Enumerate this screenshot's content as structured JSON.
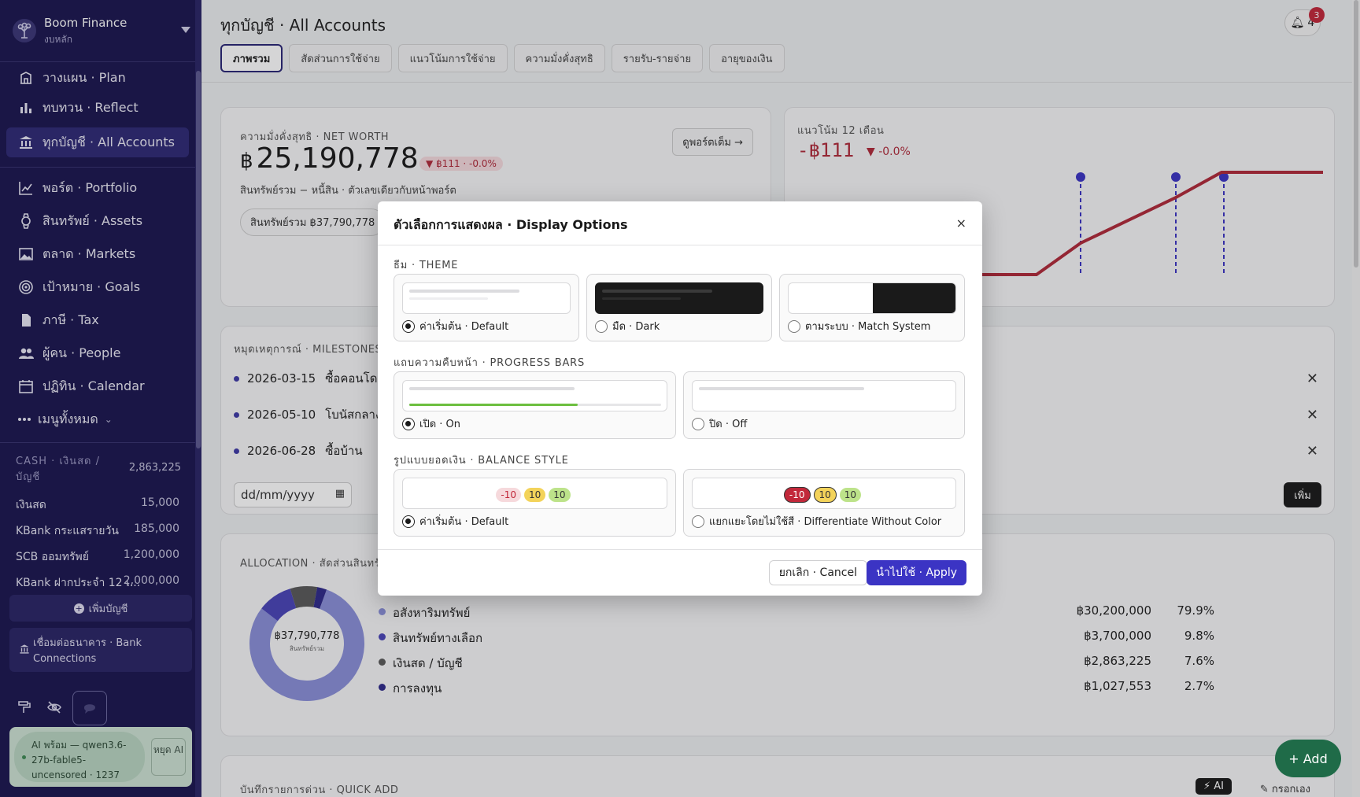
{
  "sidebar": {
    "brand_name": "Boom Finance",
    "brand_sub": "งบหลัก",
    "nav": [
      {
        "label": "วางแผน · Plan",
        "icon": "plan-icon"
      },
      {
        "label": "ทบทวน · Reflect",
        "icon": "reflect-icon"
      },
      {
        "label": "ทุกบัญชี · All Accounts",
        "icon": "bank-icon"
      },
      {
        "label": "พอร์ต · Portfolio",
        "icon": "portfolio-icon"
      },
      {
        "label": "สินทรัพย์ · Assets",
        "icon": "assets-icon"
      },
      {
        "label": "ตลาด · Markets",
        "icon": "markets-icon"
      },
      {
        "label": "เป้าหมาย · Goals",
        "icon": "goals-icon"
      },
      {
        "label": "ภาษี · Tax",
        "icon": "tax-icon"
      },
      {
        "label": "ผู้คน · People",
        "icon": "people-icon"
      },
      {
        "label": "ปฏิทิน · Calendar",
        "icon": "calendar-icon"
      }
    ],
    "more_label": "เมนูทั้งหมด",
    "cash_header": "CASH · เงินสด / บัญชี",
    "cash_total": "2,863,225",
    "accounts": [
      {
        "name": "เงินสด",
        "value": "15,000"
      },
      {
        "name": "KBank กระแสรายวัน",
        "value": "185,000"
      },
      {
        "name": "SCB ออมทรัพย์",
        "value": "1,200,000"
      },
      {
        "name": "KBank ฝากประจำ 12 เ...",
        "value": "2,000,000"
      }
    ],
    "add_account": "เพิ่มบัญชี",
    "bank_connections": "เชื่อมต่อธนาคาร · Bank Connections",
    "ai_status": "AI พร้อม — qwen3.6-27b-fable5-uncensored · 1237",
    "ai_stop": "หยุด AI"
  },
  "header": {
    "title": "ทุกบัญชี · All Accounts",
    "notif_count": "4",
    "notif_badge": "3",
    "tabs": [
      "ภาพรวม",
      "สัดส่วนการใช้จ่าย",
      "แนวโน้มการใช้จ่าย",
      "ความมั่งคั่งสุทธิ",
      "รายรับ-รายจ่าย",
      "อายุของเงิน"
    ]
  },
  "networth": {
    "label": "ความมั่งคั่งสุทธิ · NET WORTH",
    "currency": "฿",
    "value": "25,190,778",
    "delta": "▼ ฿111 · -0.0%",
    "sub": "สินทรัพย์รวม − หนี้สิน · ตัวเลขเดียวกับหน้าพอร์ต",
    "button": "ดูพอร์ตเต็ม →",
    "assets_pill": "สินทรัพย์รวม ฿37,790,778"
  },
  "trend": {
    "label": "แนวโน้ม 12 เดือน",
    "value": "-฿111",
    "pct": "▼ -0.0%"
  },
  "milestones": {
    "label": "หมุดเหตุการณ์ · MILESTONES",
    "items": [
      {
        "date": "2026-03-15",
        "text": "ซื้อคอนโดใ"
      },
      {
        "date": "2026-05-10",
        "text": "โบนัสกลางปี"
      },
      {
        "date": "2026-06-28",
        "text": "ซื้อบ้าน"
      }
    ],
    "date_placeholder": "dd/mm/yyyy",
    "add_label": "เพิ่ม"
  },
  "allocation": {
    "label": "ALLOCATION · สัดส่วนสินทรั",
    "center_value": "฿37,790,778",
    "center_label": "สินทรัพย์รวม",
    "rows": [
      {
        "name": "อสังหาริมทรัพย์",
        "amount": "฿30,200,000",
        "pct": "79.9%",
        "color": "#8a8fd8",
        "fraction": 0.799
      },
      {
        "name": "สินทรัพย์ทางเลือก",
        "amount": "฿3,700,000",
        "pct": "9.8%",
        "color": "#4a45b8",
        "fraction": 0.098
      },
      {
        "name": "เงินสด / บัญชี",
        "amount": "฿2,863,225",
        "pct": "7.6%",
        "color": "#5a5a5a",
        "fraction": 0.076
      },
      {
        "name": "การลงทุน",
        "amount": "฿1,027,553",
        "pct": "2.7%",
        "color": "#2f2a8a",
        "fraction": 0.027
      }
    ]
  },
  "quick_add": {
    "label": "บันทึกรายการด่วน · QUICK ADD",
    "ai_label": "⚡ AI",
    "manual_label": "✎ กรอกเอง"
  },
  "fab_label": "+ Add",
  "modal": {
    "title": "ตัวเลือกการแสดงผล · Display Options",
    "close": "×",
    "theme": {
      "label": "ธีม · THEME",
      "options": [
        "ค่าเริ่มต้น · Default",
        "มืด · Dark",
        "ตามระบบ · Match System"
      ],
      "selected": 0
    },
    "progress": {
      "label": "แถบความคืบหน้า · PROGRESS BARS",
      "options": [
        "เปิด · On",
        "ปิด · Off"
      ],
      "selected": 0
    },
    "balance": {
      "label": "รูปแบบยอดเงิน · BALANCE STYLE",
      "options": [
        "ค่าเริ่มต้น · Default",
        "แยกแยะโดยไม่ใช้สี · Differentiate Without Color"
      ],
      "selected": 0,
      "chips": [
        "-10",
        "10",
        "10"
      ]
    },
    "cancel": "ยกเลิก · Cancel",
    "apply": "นำไปใช้ · Apply"
  },
  "colors": {
    "sidebar_bg": "#1b1750",
    "accent": "#3b34c4",
    "negative": "#b02a3a",
    "fab": "#1f6b48"
  }
}
